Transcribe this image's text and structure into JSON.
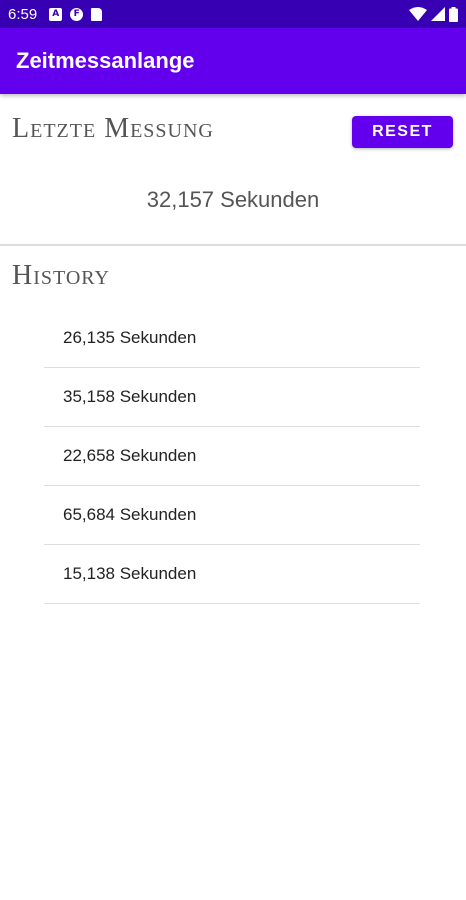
{
  "status_bar": {
    "time": "6:59",
    "notification_icons": [
      "a-icon",
      "circle-f-icon",
      "sd-card-icon"
    ],
    "system_icons": [
      "wifi-icon",
      "signal-icon",
      "battery-icon"
    ]
  },
  "app_bar": {
    "title": "Zeitmessanlange",
    "color": "#6200ee"
  },
  "last_measurement": {
    "header": "Letzte Messung",
    "reset_label": "RESET",
    "value": "32,157 Sekunden"
  },
  "history": {
    "header": "History",
    "items": [
      "26,135 Sekunden",
      "35,158 Sekunden",
      "22,658 Sekunden",
      "65,684 Sekunden",
      "15,138 Sekunden"
    ]
  }
}
